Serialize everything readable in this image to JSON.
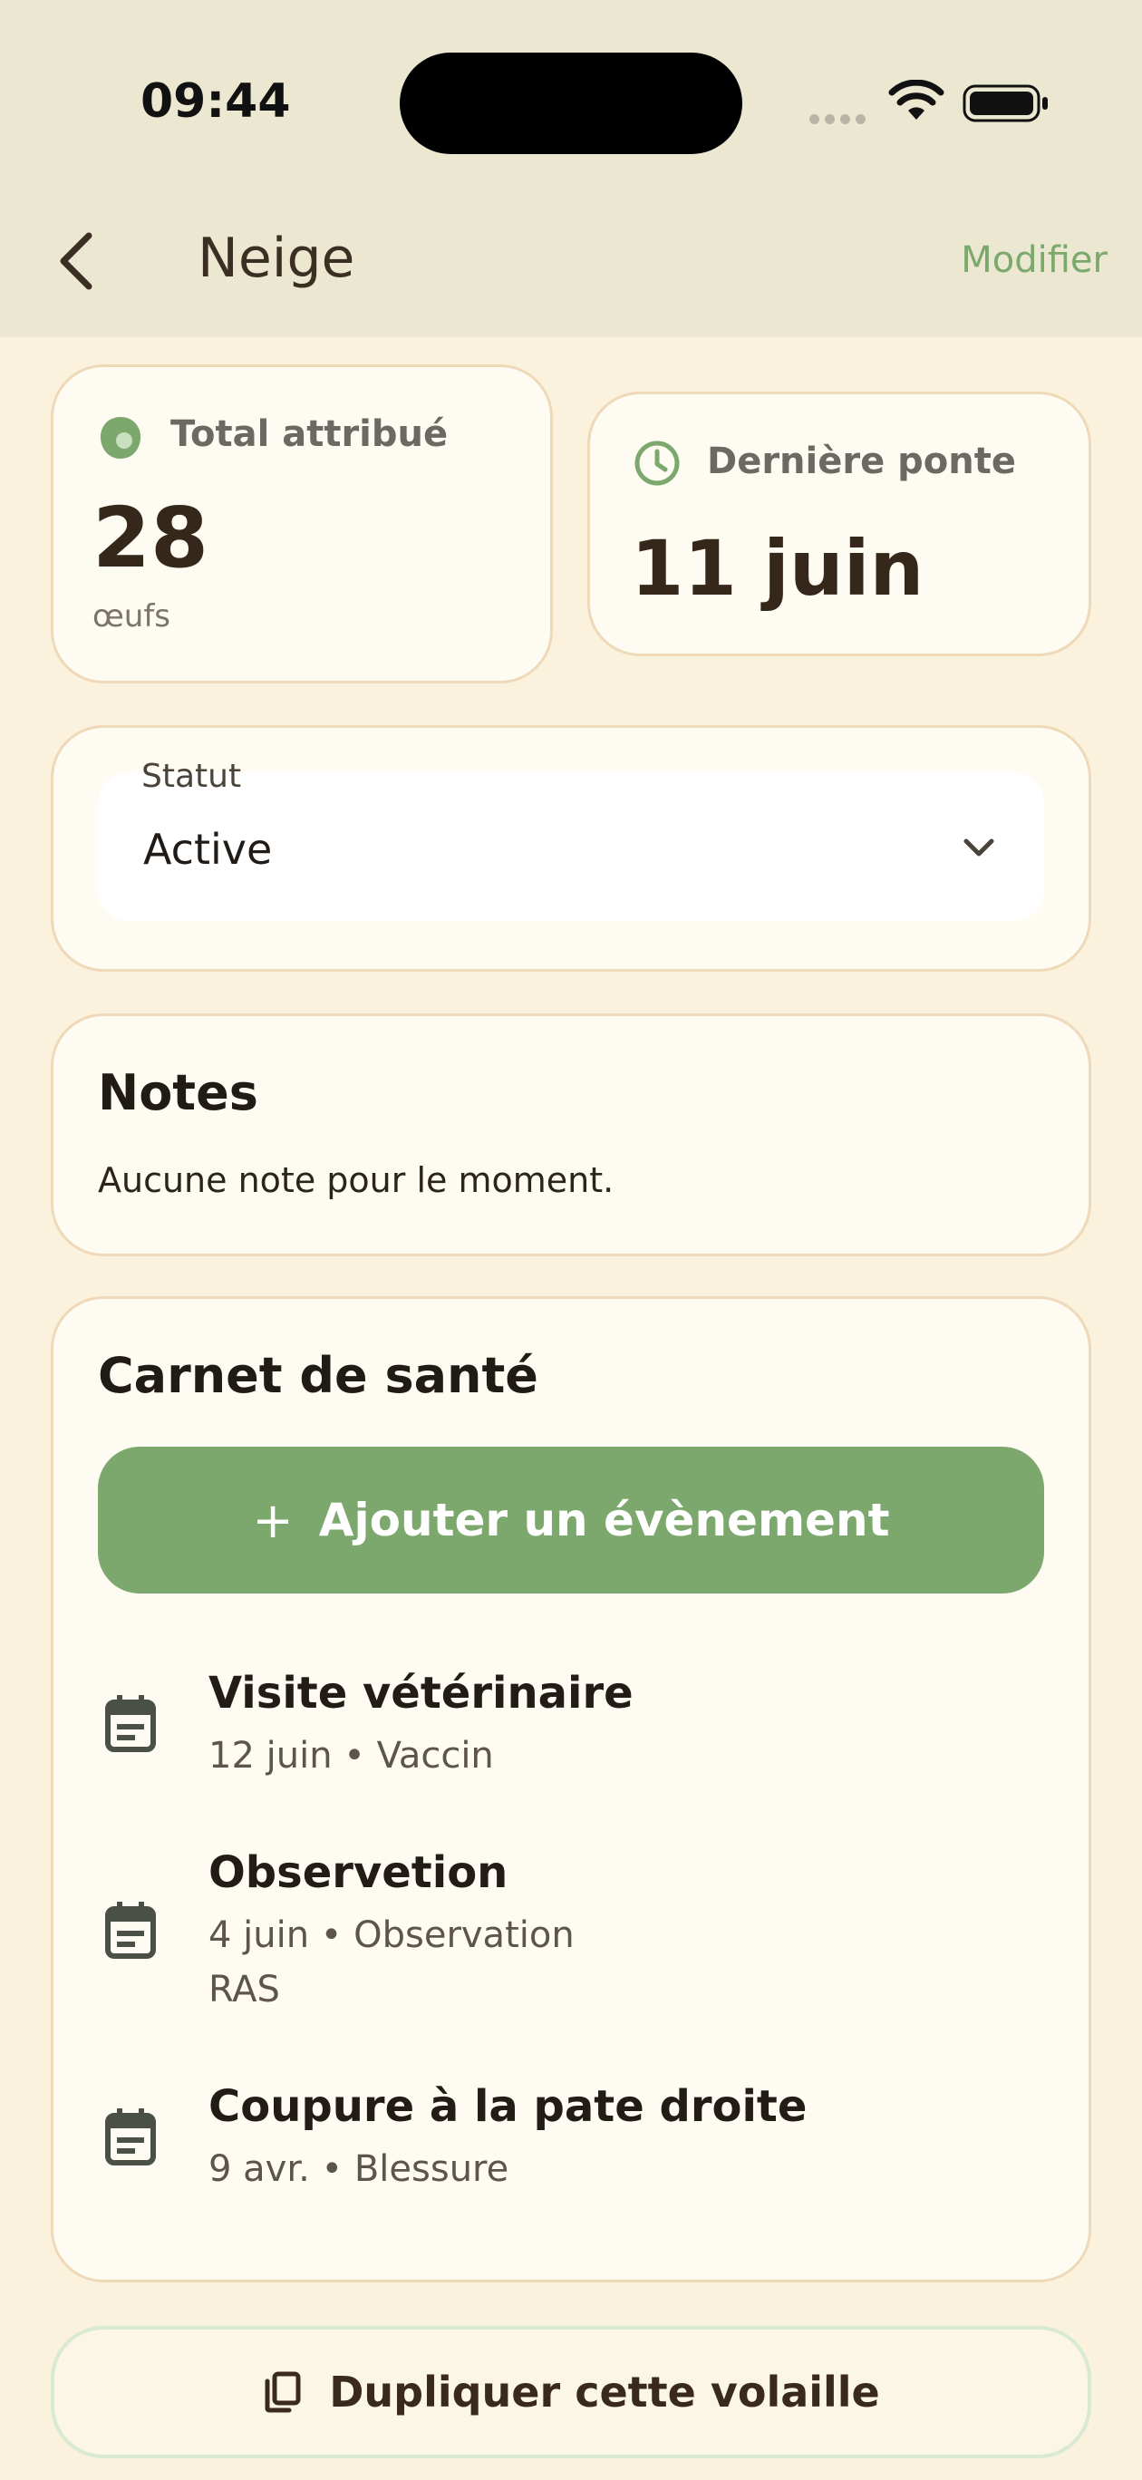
{
  "status_bar": {
    "time": "09:44"
  },
  "nav": {
    "title": "Neige",
    "edit_label": "Modifier",
    "back_icon": "chevron-left-icon"
  },
  "stats": {
    "total": {
      "label": "Total attribué",
      "value": "28",
      "unit": "œufs",
      "icon": "egg-icon"
    },
    "last_lay": {
      "label": "Dernière ponte",
      "value": "11 juin",
      "icon": "clock-icon"
    }
  },
  "status": {
    "label": "Statut",
    "value": "Active"
  },
  "notes": {
    "title": "Notes",
    "text": "Aucune note pour le moment."
  },
  "health": {
    "title": "Carnet de santé",
    "add_label": "Ajouter un évènement",
    "events": [
      {
        "title": "Visite vétérinaire",
        "meta": "12 juin • Vaccin",
        "note": ""
      },
      {
        "title": "Observetion",
        "meta": "4 juin • Observation",
        "note": "RAS"
      },
      {
        "title": "Coupure à la pate droite",
        "meta": "9 avr. • Blessure",
        "note": ""
      }
    ]
  },
  "duplicate_label": "Dupliquer cette volaille",
  "colors": {
    "accent_green": "#7ca86d",
    "background": "#fbf2dd",
    "header": "#ebe7d0",
    "card": "#fefbf3",
    "card_border": "#eed9b9"
  }
}
